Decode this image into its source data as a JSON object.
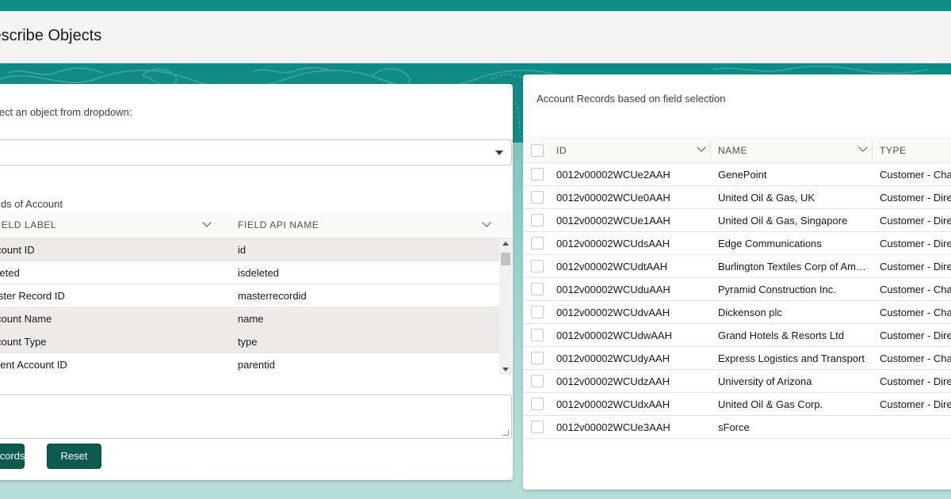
{
  "header": {
    "title": "Describe Objects"
  },
  "left_panel": {
    "select_label": "Select an object from dropdown:",
    "combobox_value": "",
    "fields_title": "Fields of Account",
    "fields_table": {
      "columns": [
        "Field Label",
        "Field API Name"
      ],
      "rows": [
        {
          "label": "Account ID",
          "api": "id",
          "selected": true
        },
        {
          "label": "Deleted",
          "api": "isdeleted",
          "selected": false
        },
        {
          "label": "Master Record ID",
          "api": "masterrecordid",
          "selected": false
        },
        {
          "label": "Account Name",
          "api": "name",
          "selected": true
        },
        {
          "label": "Account Type",
          "api": "type",
          "selected": true
        },
        {
          "label": "Parent Account ID",
          "api": "parentid",
          "selected": false
        }
      ]
    },
    "query_text": "",
    "buttons": {
      "fetch": "Fetch Records",
      "reset": "Reset"
    }
  },
  "right_panel": {
    "title": "Account Records based on field selection",
    "columns": [
      "ID",
      "NAME",
      "TYPE"
    ],
    "rows": [
      {
        "id": "0012v00002WCUe2AAH",
        "name": "GenePoint",
        "type": "Customer - Channel"
      },
      {
        "id": "0012v00002WCUe0AAH",
        "name": "United Oil & Gas, UK",
        "type": "Customer - Direct"
      },
      {
        "id": "0012v00002WCUe1AAH",
        "name": "United Oil & Gas, Singapore",
        "type": "Customer - Direct"
      },
      {
        "id": "0012v00002WCUdsAAH",
        "name": "Edge Communications",
        "type": "Customer - Direct"
      },
      {
        "id": "0012v00002WCUdtAAH",
        "name": "Burlington Textiles Corp of America",
        "type": "Customer - Direct"
      },
      {
        "id": "0012v00002WCUduAAH",
        "name": "Pyramid Construction Inc.",
        "type": "Customer - Channel"
      },
      {
        "id": "0012v00002WCUdvAAH",
        "name": "Dickenson plc",
        "type": "Customer - Channel"
      },
      {
        "id": "0012v00002WCUdwAAH",
        "name": "Grand Hotels & Resorts Ltd",
        "type": "Customer - Direct"
      },
      {
        "id": "0012v00002WCUdyAAH",
        "name": "Express Logistics and Transport",
        "type": "Customer - Channel"
      },
      {
        "id": "0012v00002WCUdzAAH",
        "name": "University of Arizona",
        "type": "Customer - Direct"
      },
      {
        "id": "0012v00002WCUdxAAH",
        "name": "United Oil & Gas Corp.",
        "type": "Customer - Direct"
      },
      {
        "id": "0012v00002WCUe3AAH",
        "name": "sForce",
        "type": ""
      }
    ]
  },
  "colors": {
    "brand_teal": "#0f8a85",
    "button_green": "#0d5a50",
    "selected_row": "#ecebea"
  }
}
